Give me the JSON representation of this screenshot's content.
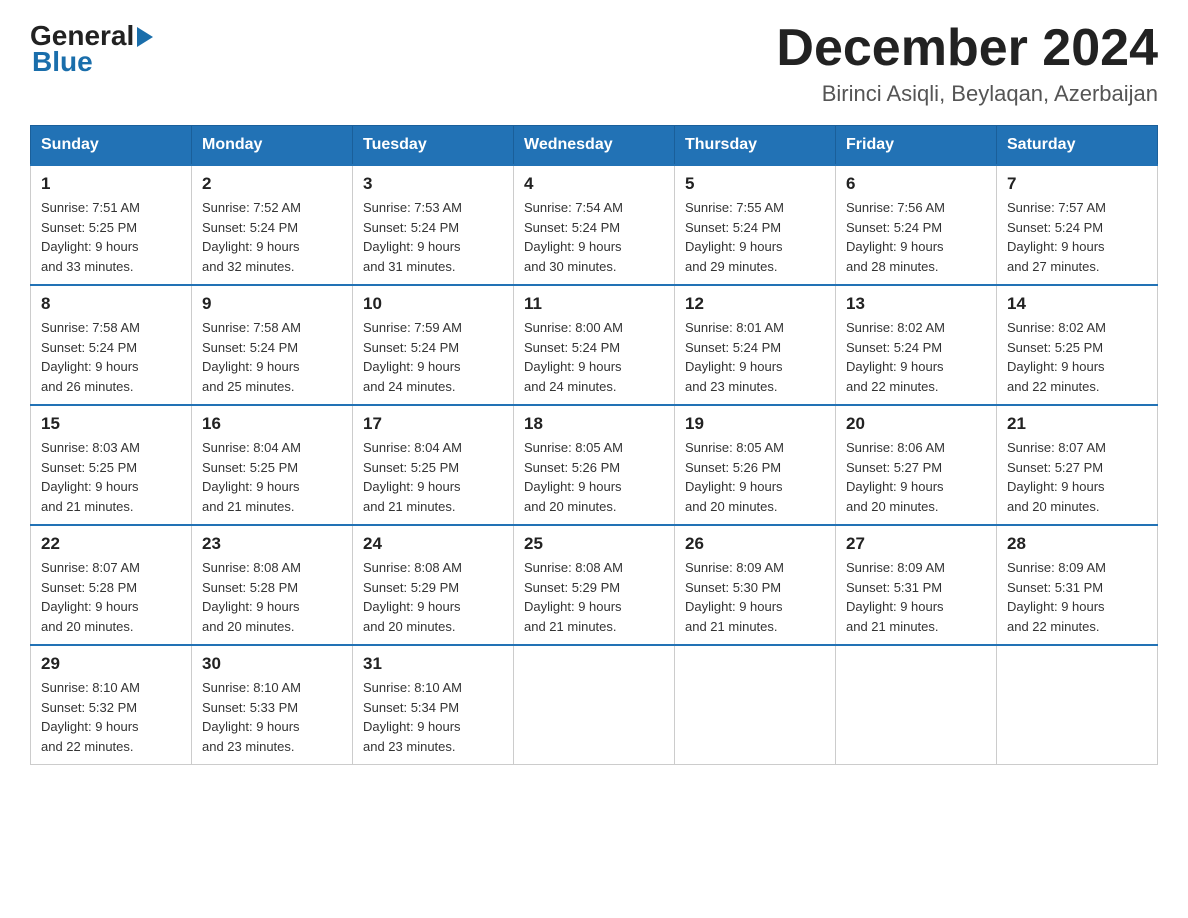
{
  "logo": {
    "general": "General",
    "blue": "Blue"
  },
  "header": {
    "title": "December 2024",
    "subtitle": "Birinci Asiqli, Beylaqan, Azerbaijan"
  },
  "weekdays": [
    "Sunday",
    "Monday",
    "Tuesday",
    "Wednesday",
    "Thursday",
    "Friday",
    "Saturday"
  ],
  "weeks": [
    [
      {
        "day": "1",
        "sunrise": "7:51 AM",
        "sunset": "5:25 PM",
        "daylight": "9 hours and 33 minutes."
      },
      {
        "day": "2",
        "sunrise": "7:52 AM",
        "sunset": "5:24 PM",
        "daylight": "9 hours and 32 minutes."
      },
      {
        "day": "3",
        "sunrise": "7:53 AM",
        "sunset": "5:24 PM",
        "daylight": "9 hours and 31 minutes."
      },
      {
        "day": "4",
        "sunrise": "7:54 AM",
        "sunset": "5:24 PM",
        "daylight": "9 hours and 30 minutes."
      },
      {
        "day": "5",
        "sunrise": "7:55 AM",
        "sunset": "5:24 PM",
        "daylight": "9 hours and 29 minutes."
      },
      {
        "day": "6",
        "sunrise": "7:56 AM",
        "sunset": "5:24 PM",
        "daylight": "9 hours and 28 minutes."
      },
      {
        "day": "7",
        "sunrise": "7:57 AM",
        "sunset": "5:24 PM",
        "daylight": "9 hours and 27 minutes."
      }
    ],
    [
      {
        "day": "8",
        "sunrise": "7:58 AM",
        "sunset": "5:24 PM",
        "daylight": "9 hours and 26 minutes."
      },
      {
        "day": "9",
        "sunrise": "7:58 AM",
        "sunset": "5:24 PM",
        "daylight": "9 hours and 25 minutes."
      },
      {
        "day": "10",
        "sunrise": "7:59 AM",
        "sunset": "5:24 PM",
        "daylight": "9 hours and 24 minutes."
      },
      {
        "day": "11",
        "sunrise": "8:00 AM",
        "sunset": "5:24 PM",
        "daylight": "9 hours and 24 minutes."
      },
      {
        "day": "12",
        "sunrise": "8:01 AM",
        "sunset": "5:24 PM",
        "daylight": "9 hours and 23 minutes."
      },
      {
        "day": "13",
        "sunrise": "8:02 AM",
        "sunset": "5:24 PM",
        "daylight": "9 hours and 22 minutes."
      },
      {
        "day": "14",
        "sunrise": "8:02 AM",
        "sunset": "5:25 PM",
        "daylight": "9 hours and 22 minutes."
      }
    ],
    [
      {
        "day": "15",
        "sunrise": "8:03 AM",
        "sunset": "5:25 PM",
        "daylight": "9 hours and 21 minutes."
      },
      {
        "day": "16",
        "sunrise": "8:04 AM",
        "sunset": "5:25 PM",
        "daylight": "9 hours and 21 minutes."
      },
      {
        "day": "17",
        "sunrise": "8:04 AM",
        "sunset": "5:25 PM",
        "daylight": "9 hours and 21 minutes."
      },
      {
        "day": "18",
        "sunrise": "8:05 AM",
        "sunset": "5:26 PM",
        "daylight": "9 hours and 20 minutes."
      },
      {
        "day": "19",
        "sunrise": "8:05 AM",
        "sunset": "5:26 PM",
        "daylight": "9 hours and 20 minutes."
      },
      {
        "day": "20",
        "sunrise": "8:06 AM",
        "sunset": "5:27 PM",
        "daylight": "9 hours and 20 minutes."
      },
      {
        "day": "21",
        "sunrise": "8:07 AM",
        "sunset": "5:27 PM",
        "daylight": "9 hours and 20 minutes."
      }
    ],
    [
      {
        "day": "22",
        "sunrise": "8:07 AM",
        "sunset": "5:28 PM",
        "daylight": "9 hours and 20 minutes."
      },
      {
        "day": "23",
        "sunrise": "8:08 AM",
        "sunset": "5:28 PM",
        "daylight": "9 hours and 20 minutes."
      },
      {
        "day": "24",
        "sunrise": "8:08 AM",
        "sunset": "5:29 PM",
        "daylight": "9 hours and 20 minutes."
      },
      {
        "day": "25",
        "sunrise": "8:08 AM",
        "sunset": "5:29 PM",
        "daylight": "9 hours and 21 minutes."
      },
      {
        "day": "26",
        "sunrise": "8:09 AM",
        "sunset": "5:30 PM",
        "daylight": "9 hours and 21 minutes."
      },
      {
        "day": "27",
        "sunrise": "8:09 AM",
        "sunset": "5:31 PM",
        "daylight": "9 hours and 21 minutes."
      },
      {
        "day": "28",
        "sunrise": "8:09 AM",
        "sunset": "5:31 PM",
        "daylight": "9 hours and 22 minutes."
      }
    ],
    [
      {
        "day": "29",
        "sunrise": "8:10 AM",
        "sunset": "5:32 PM",
        "daylight": "9 hours and 22 minutes."
      },
      {
        "day": "30",
        "sunrise": "8:10 AM",
        "sunset": "5:33 PM",
        "daylight": "9 hours and 23 minutes."
      },
      {
        "day": "31",
        "sunrise": "8:10 AM",
        "sunset": "5:34 PM",
        "daylight": "9 hours and 23 minutes."
      },
      null,
      null,
      null,
      null
    ]
  ],
  "labels": {
    "sunrise": "Sunrise:",
    "sunset": "Sunset:",
    "daylight": "Daylight:"
  }
}
